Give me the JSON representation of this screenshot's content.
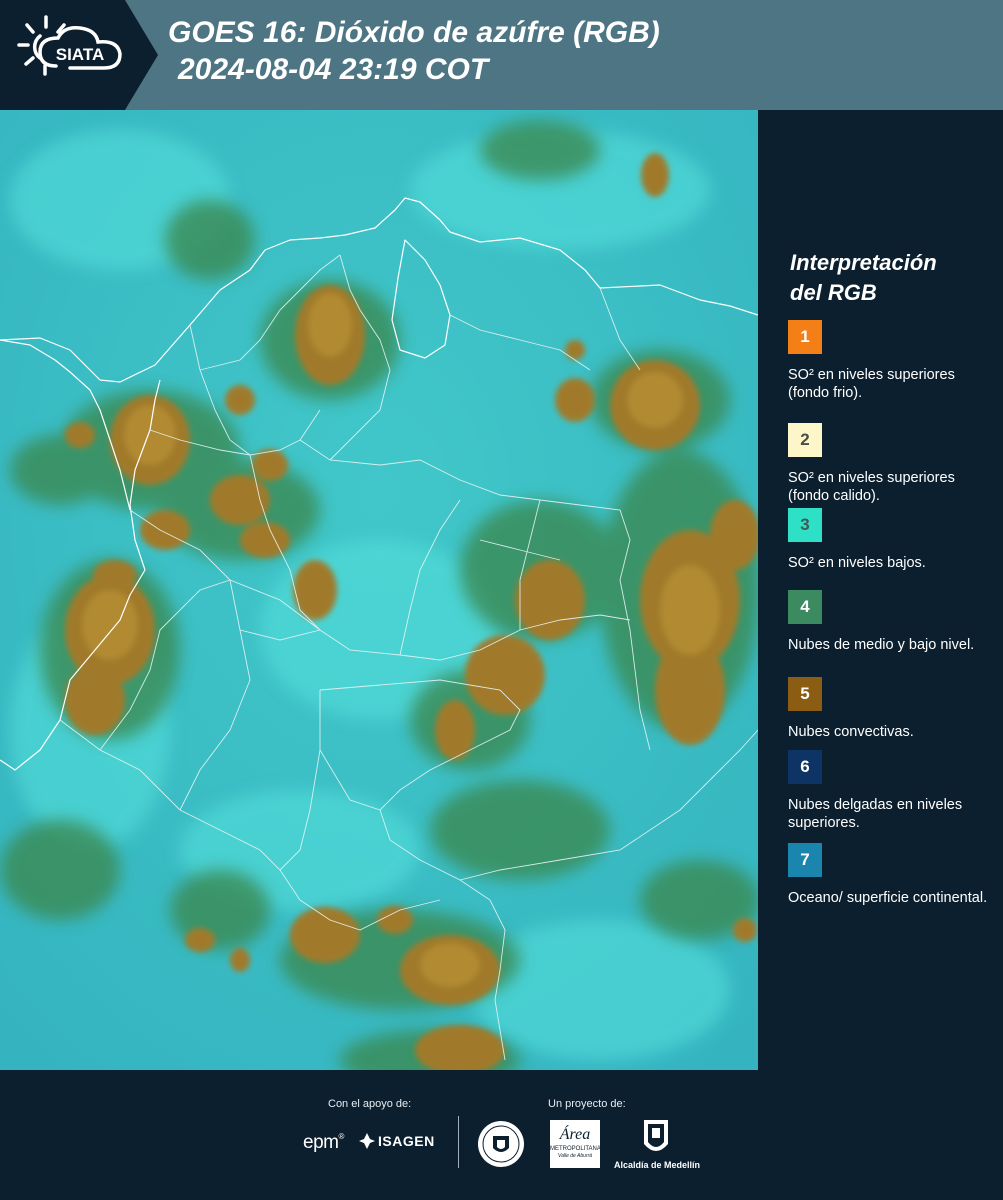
{
  "header": {
    "logo_text": "SIATA",
    "title_line1": "GOES 16: Dióxido de azúfre (RGB)",
    "title_line2": "2024-08-04 23:19 COT"
  },
  "legend": {
    "title_line1": "Interpretación",
    "title_line2": "del RGB",
    "items": [
      {
        "num": "1",
        "color": "#f57f17",
        "num_color": "#ffffff",
        "label": "SO² en niveles superiores (fondo frio)."
      },
      {
        "num": "2",
        "color": "#fdf6c8",
        "num_color": "#4a4a4a",
        "label": "SO² en niveles superiores (fondo calido)."
      },
      {
        "num": "3",
        "color": "#2de0c6",
        "num_color": "#3a5b56",
        "label": "SO² en niveles bajos."
      },
      {
        "num": "4",
        "color": "#3c8a60",
        "num_color": "#ffffff",
        "label": "Nubes de medio y bajo nivel."
      },
      {
        "num": "5",
        "color": "#8a5d12",
        "num_color": "#ffffff",
        "label": "Nubes convectivas."
      },
      {
        "num": "6",
        "color": "#0e3466",
        "num_color": "#ffffff",
        "label": "Nubes delgadas en niveles superiores."
      },
      {
        "num": "7",
        "color": "#1b86ad",
        "num_color": "#ffffff",
        "label": "Oceano/ superficie continental."
      }
    ]
  },
  "footer": {
    "support_label": "Con el apoyo de:",
    "project_label": "Un proyecto de:",
    "logo_epm": "epm",
    "logo_isagen": "ISAGEN",
    "logo_area_main": "Área",
    "logo_area_sub1": "METROPOLITANA",
    "logo_area_sub2": "Valle de Aburrá",
    "logo_alcaldia": "Alcaldía de Medellín"
  }
}
